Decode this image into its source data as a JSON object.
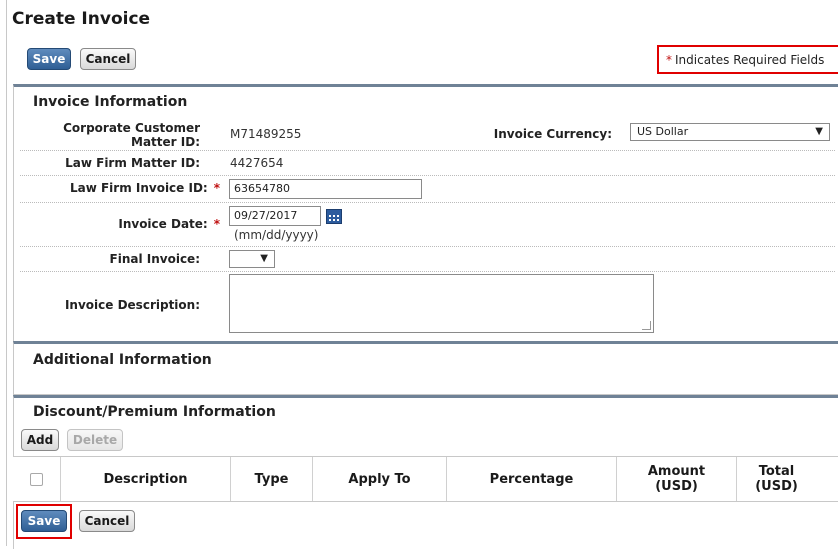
{
  "page": {
    "title": "Create Invoice",
    "required_note": "Indicates Required Fields",
    "required_star": "*"
  },
  "toolbar": {
    "save_label": "Save",
    "cancel_label": "Cancel"
  },
  "invoice_info": {
    "heading": "Invoice Information",
    "corporate_customer_label_line1": "Corporate Customer",
    "corporate_customer_label_line2": "Matter ID:",
    "corporate_customer_value": "M71489255",
    "currency_label": "Invoice Currency:",
    "currency_value": "US Dollar",
    "law_firm_matter_label": "Law Firm Matter ID:",
    "law_firm_matter_value": "4427654",
    "law_firm_invoice_label": "Law Firm Invoice ID:",
    "law_firm_invoice_value": "63654780",
    "invoice_date_label": "Invoice Date:",
    "invoice_date_value": "09/27/2017",
    "invoice_date_hint": "(mm/dd/yyyy)",
    "final_invoice_label": "Final Invoice:",
    "final_invoice_value": "",
    "description_label": "Invoice Description:",
    "description_value": ""
  },
  "additional_info": {
    "heading": "Additional Information"
  },
  "discount": {
    "heading": "Discount/Premium Information",
    "add_label": "Add",
    "delete_label": "Delete",
    "columns": {
      "description": "Description",
      "type": "Type",
      "apply_to": "Apply To",
      "percentage": "Percentage",
      "amount_line1": "Amount",
      "amount_line2": "(USD)",
      "total_line1": "Total",
      "total_line2": "(USD)"
    }
  },
  "colors": {
    "save_button": "#2f5f95",
    "required_star": "#c01010",
    "highlight_outline": "#e00000",
    "panel_border": "#6f8296"
  },
  "icons": {
    "calendar": "calendar-icon",
    "dropdown": "chevron-down-icon",
    "resize": "resize-grip-icon"
  }
}
